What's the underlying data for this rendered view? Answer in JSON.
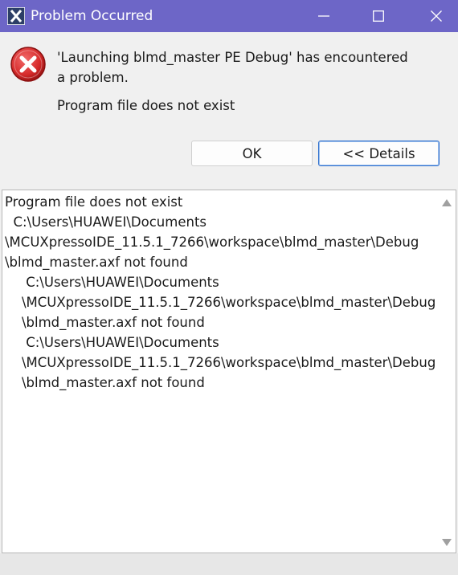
{
  "window": {
    "title": "Problem Occurred",
    "app_icon": "eclipse-x-icon",
    "controls": {
      "minimize_icon": "minimize-icon",
      "maximize_icon": "maximize-icon",
      "close_icon": "close-icon"
    }
  },
  "dialog": {
    "icon": "error-icon",
    "message": "'Launching blmd_master PE Debug' has encountered a problem.",
    "reason": "Program file does not exist",
    "buttons": {
      "ok_label": "OK",
      "details_label": "<< Details"
    }
  },
  "details": {
    "text": "Program file does not exist\n  C:\\Users\\HUAWEI\\Documents\n\\MCUXpressoIDE_11.5.1_7266\\workspace\\blmd_master\\Debug\n\\blmd_master.axf not found\n     C:\\Users\\HUAWEI\\Documents\n    \\MCUXpressoIDE_11.5.1_7266\\workspace\\blmd_master\\Debug\n    \\blmd_master.axf not found\n     C:\\Users\\HUAWEI\\Documents\n    \\MCUXpressoIDE_11.5.1_7266\\workspace\\blmd_master\\Debug\n    \\blmd_master.axf not found"
  },
  "colors": {
    "titlebar": "#6d66c7",
    "error_red": "#d62b2b",
    "default_button_border": "#2d6fcf"
  }
}
